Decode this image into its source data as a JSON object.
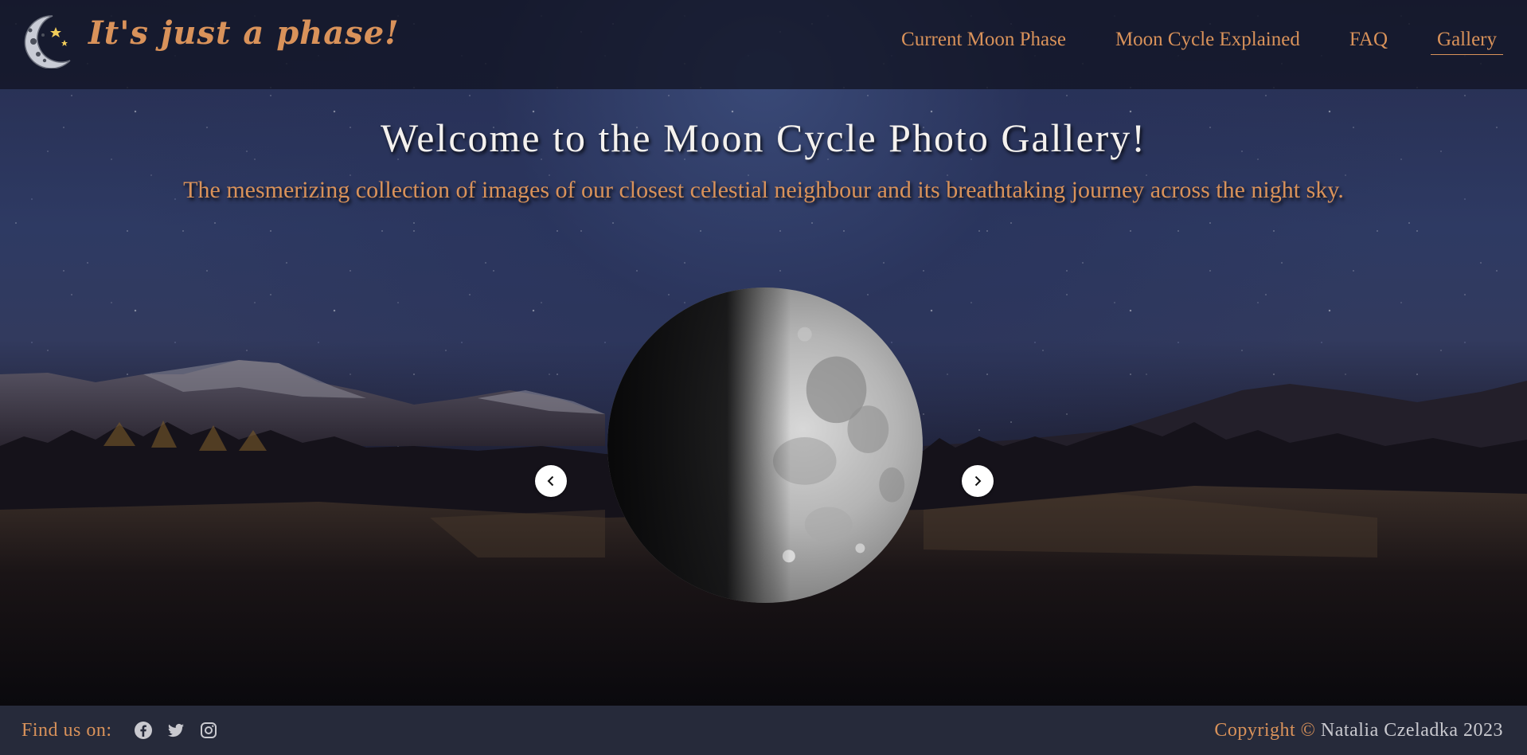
{
  "header": {
    "site_title": "It's just a phase!",
    "logo_icon": "crescent-moon-stars-icon",
    "nav": [
      {
        "label": "Current Moon Phase",
        "active": false
      },
      {
        "label": "Moon Cycle Explained",
        "active": false
      },
      {
        "label": "FAQ",
        "active": false
      },
      {
        "label": "Gallery",
        "active": true
      }
    ]
  },
  "hero": {
    "title": "Welcome to the Moon Cycle Photo Gallery!",
    "subtitle": "The mesmerizing collection of images of our closest celestial neighbour and its breathtaking journey across the night sky."
  },
  "carousel": {
    "current_slide": "first-quarter-moon",
    "prev_icon": "chevron-left-icon",
    "next_icon": "chevron-right-icon"
  },
  "footer": {
    "find_label": "Find us on:",
    "socials": [
      "facebook-icon",
      "twitter-icon",
      "instagram-icon"
    ],
    "copyright_label": "Copyright ©",
    "copyright_owner": "Natalia Czeladka 2023"
  },
  "colors": {
    "accent": "#d9925a",
    "header_bg": "#12142499",
    "footer_bg": "#262a3a",
    "title_text": "#f4f1ee",
    "footer_text": "#c9c9cf"
  }
}
